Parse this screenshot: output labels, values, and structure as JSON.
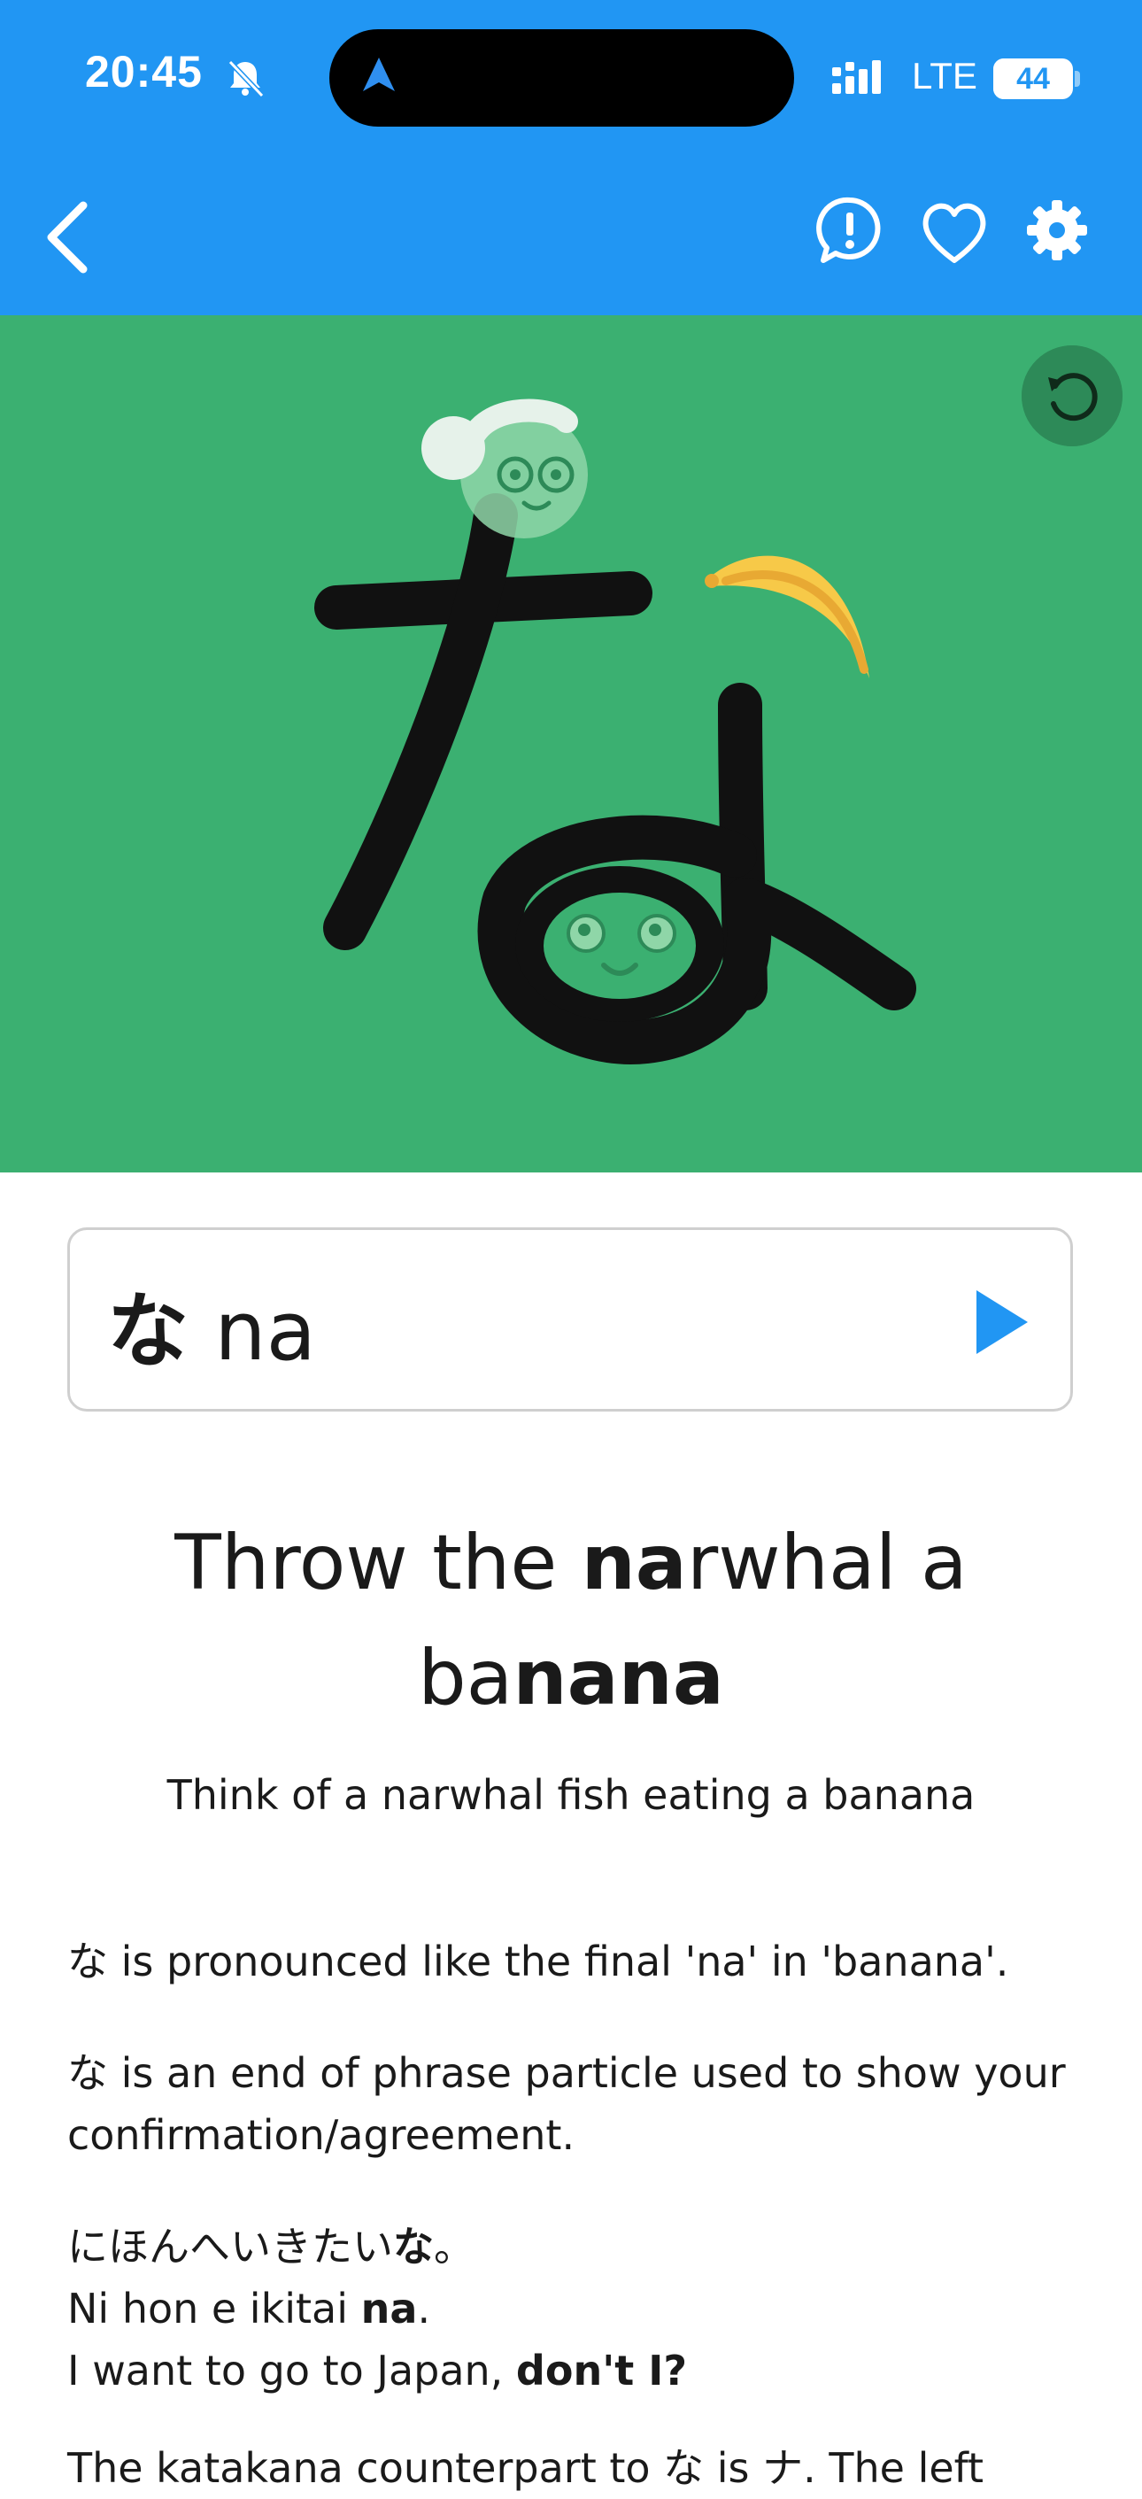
{
  "status_bar": {
    "time": "20:45",
    "network": "LTE",
    "battery": "44",
    "battery_level": 0.44
  },
  "toolbar": {
    "icons": [
      "back-chevron-icon",
      "report-icon",
      "heart-icon",
      "gear-icon"
    ]
  },
  "hero": {
    "icons": [
      "replay-icon"
    ],
    "colors": {
      "background": "#3bb071",
      "replay": "#2d8a58"
    }
  },
  "card": {
    "kana": "な",
    "romaji": "na"
  },
  "mnemonic": {
    "part1": "Throw the ",
    "bold1": "na",
    "part2": "rwhal a ba",
    "bold2": "nana",
    "hint": "Think of a narwhal fish eating a banana"
  },
  "notes": {
    "pronunciation": "な is pronounced like the final 'na' in 'banana'.",
    "usage": "な is an end of phrase particle used to show your confirmation/agreement.",
    "example_jp_pre": "にほんへいきたい",
    "example_jp_bold": "な",
    "example_jp_post": "。",
    "example_romaji_pre": "Ni hon e ikitai ",
    "example_romaji_bold": "na",
    "example_romaji_post": ".",
    "example_en_pre": "I want to go to Japan, ",
    "example_en_bold": "don't I?",
    "katakana_note": "The katakana counterpart to な is ナ. The left"
  },
  "colors": {
    "primary": "#2196f3",
    "text": "#1a1a1a"
  }
}
